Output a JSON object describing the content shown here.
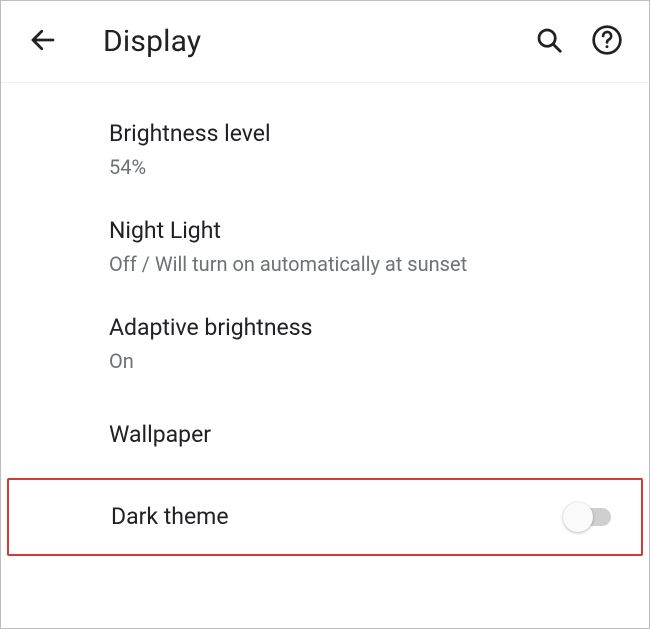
{
  "header": {
    "title": "Display"
  },
  "settings": {
    "brightness": {
      "title": "Brightness level",
      "sub": "54%"
    },
    "nightlight": {
      "title": "Night Light",
      "sub": "Off / Will turn on automatically at sunset"
    },
    "adaptive": {
      "title": "Adaptive brightness",
      "sub": "On"
    },
    "wallpaper": {
      "title": "Wallpaper"
    },
    "darktheme": {
      "title": "Dark theme",
      "enabled": false
    }
  }
}
